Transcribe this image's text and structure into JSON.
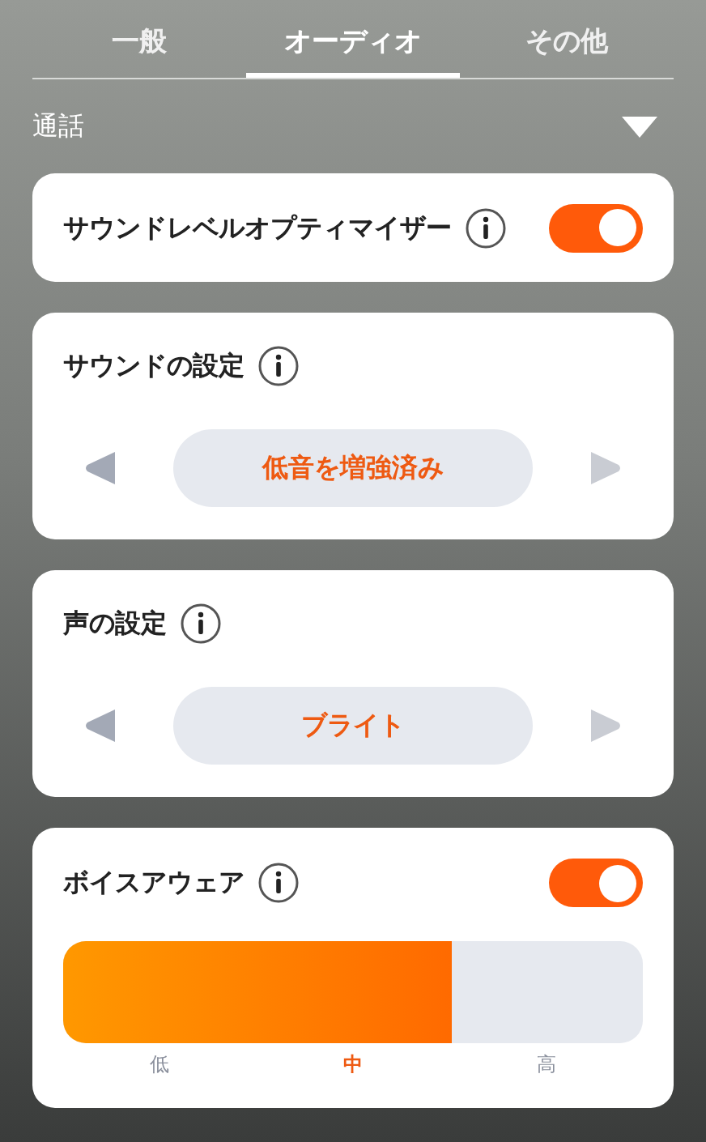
{
  "tabs": [
    {
      "label": "一般",
      "selected": false
    },
    {
      "label": "オーディオ",
      "selected": true
    },
    {
      "label": "その他",
      "selected": false
    }
  ],
  "section": {
    "title": "通話",
    "expanded": false
  },
  "cards": [
    {
      "kind": "toggle",
      "title": "サウンドレベルオプティマイザー",
      "on": true
    },
    {
      "kind": "selector",
      "title": "サウンドの設定",
      "value": "低音を増強済み",
      "prev_disabled": false,
      "next_disabled": true
    },
    {
      "kind": "selector",
      "title": "声の設定",
      "value": "ブライト",
      "prev_disabled": false,
      "next_disabled": true
    },
    {
      "kind": "level",
      "title": "ボイスアウェア",
      "on": true,
      "level": 0.67,
      "steps": [
        {
          "label": "低",
          "selected": false
        },
        {
          "label": "中",
          "selected": true
        },
        {
          "label": "高",
          "selected": false
        }
      ]
    }
  ]
}
